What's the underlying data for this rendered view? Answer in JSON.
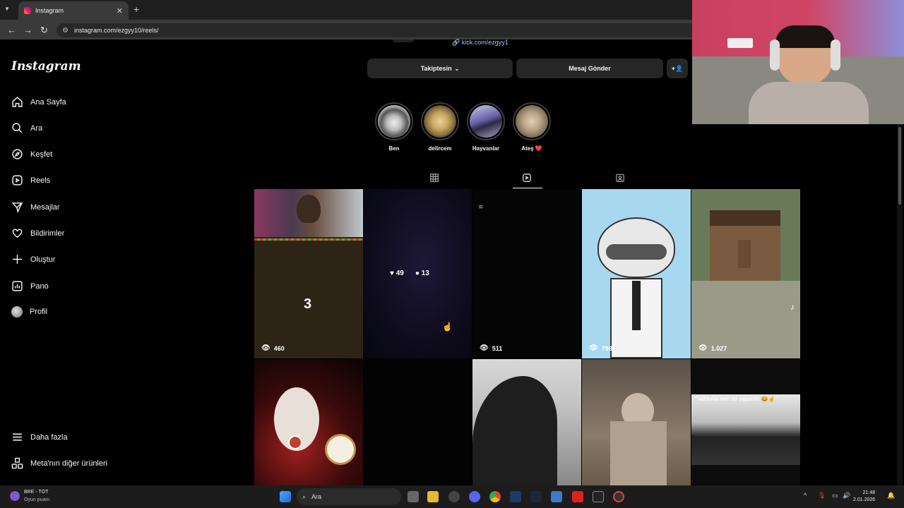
{
  "browser": {
    "tab_title": "Instagram",
    "url": "instagram.com/ezgyy10/reels/"
  },
  "sidebar": {
    "logo": "Instagram",
    "items": [
      {
        "label": "Ana Sayfa",
        "icon": "home-icon"
      },
      {
        "label": "Ara",
        "icon": "search-icon"
      },
      {
        "label": "Keşfet",
        "icon": "compass-icon"
      },
      {
        "label": "Reels",
        "icon": "reels-icon"
      },
      {
        "label": "Mesajlar",
        "icon": "messenger-icon"
      },
      {
        "label": "Bildirimler",
        "icon": "heart-icon"
      },
      {
        "label": "Oluştur",
        "icon": "plus-icon"
      },
      {
        "label": "Pano",
        "icon": "dashboard-icon"
      },
      {
        "label": "Profil",
        "icon": "avatar"
      }
    ],
    "bottom_items": [
      {
        "label": "Daha fazla",
        "icon": "menu-icon"
      },
      {
        "label": "Meta'nın diğer ürünleri",
        "icon": "meta-apps-icon"
      }
    ]
  },
  "profile": {
    "link": "kick.com/ezgyy1",
    "follow_button": "Takiptesin",
    "message_button": "Mesaj Gönder"
  },
  "highlights": [
    {
      "label": "Ben"
    },
    {
      "label": "delircem"
    },
    {
      "label": "Hayvanlar"
    },
    {
      "label": "Ateş ❤️"
    }
  ],
  "tabs": [
    {
      "name": "posts",
      "icon": "grid-icon",
      "active": false
    },
    {
      "name": "reels",
      "icon": "reels-icon",
      "active": true
    },
    {
      "name": "tagged",
      "icon": "tagged-icon",
      "active": false
    }
  ],
  "reels": [
    {
      "views": "460",
      "overlay": "3"
    },
    {
      "likes": "49",
      "comments": "13"
    },
    {
      "views": "511"
    },
    {
      "views": "788"
    },
    {
      "views": "1.027"
    },
    {},
    {},
    {},
    {},
    {
      "caption": "\"sablonla ben de yaparım 😂☝️\""
    }
  ],
  "taskbar": {
    "weather_title": "BRE - TOT",
    "weather_sub": "Oyun puanı",
    "search_placeholder": "Ara",
    "time": "21:48",
    "date": "2.01.2026"
  },
  "colors": {
    "background": "#000000",
    "pill": "#262626",
    "link": "#a0c4ff"
  }
}
